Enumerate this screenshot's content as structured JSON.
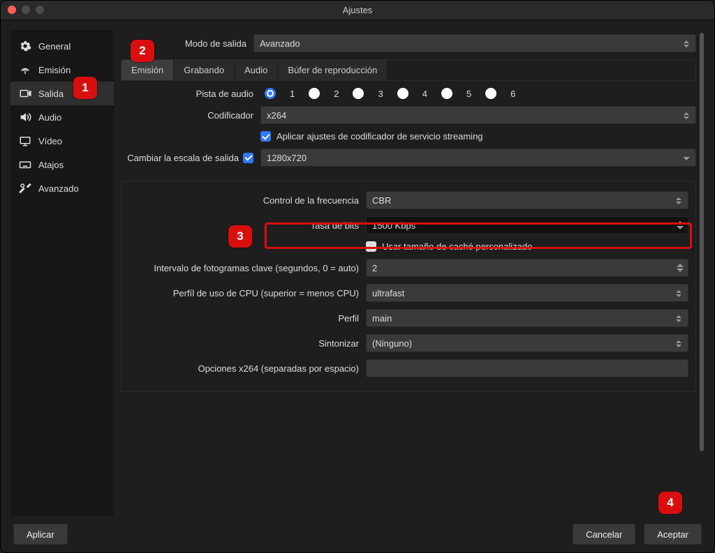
{
  "window": {
    "title": "Ajustes"
  },
  "sidebar": {
    "items": [
      {
        "label": "General"
      },
      {
        "label": "Emisión"
      },
      {
        "label": "Salida"
      },
      {
        "label": "Audio"
      },
      {
        "label": "Vídeo"
      },
      {
        "label": "Atajos"
      },
      {
        "label": "Avanzado"
      }
    ]
  },
  "output_mode": {
    "label": "Modo de salida",
    "value": "Avanzado"
  },
  "tabs": [
    "Emisión",
    "Grabando",
    "Audio",
    "Búfer de reproducción"
  ],
  "audio_track": {
    "label": "Pista de audio",
    "options": [
      "1",
      "2",
      "3",
      "4",
      "5",
      "6"
    ],
    "selected": "1"
  },
  "encoder": {
    "label": "Codificador",
    "value": "x264"
  },
  "enforce": {
    "label": "Aplicar ajustes de codificador de servicio streaming",
    "checked": true
  },
  "rescale": {
    "label": "Cambiar la escala de salida",
    "checked": true,
    "value": "1280x720"
  },
  "rate_control": {
    "label": "Control de la frecuencia",
    "value": "CBR"
  },
  "bitrate": {
    "label": "Tasa de bits",
    "value": "1500 Kbps"
  },
  "custom_buffer": {
    "label": "Usar tamaño de caché personalizado",
    "checked": false
  },
  "keyframe": {
    "label": "Intervalo de fotogramas clave (segundos, 0 = auto)",
    "value": "2"
  },
  "cpu_preset": {
    "label": "Perfíl de uso de CPU (superior = menos CPU)",
    "value": "ultrafast"
  },
  "profile": {
    "label": "Perfil",
    "value": "main"
  },
  "tune": {
    "label": "Sintonizar",
    "value": "(Ninguno)"
  },
  "x264opts": {
    "label": "Opciones x264 (separadas por espacio)",
    "value": ""
  },
  "buttons": {
    "apply": "Aplicar",
    "cancel": "Cancelar",
    "ok": "Aceptar"
  },
  "callouts": {
    "c1": "1",
    "c2": "2",
    "c3": "3",
    "c4": "4"
  }
}
